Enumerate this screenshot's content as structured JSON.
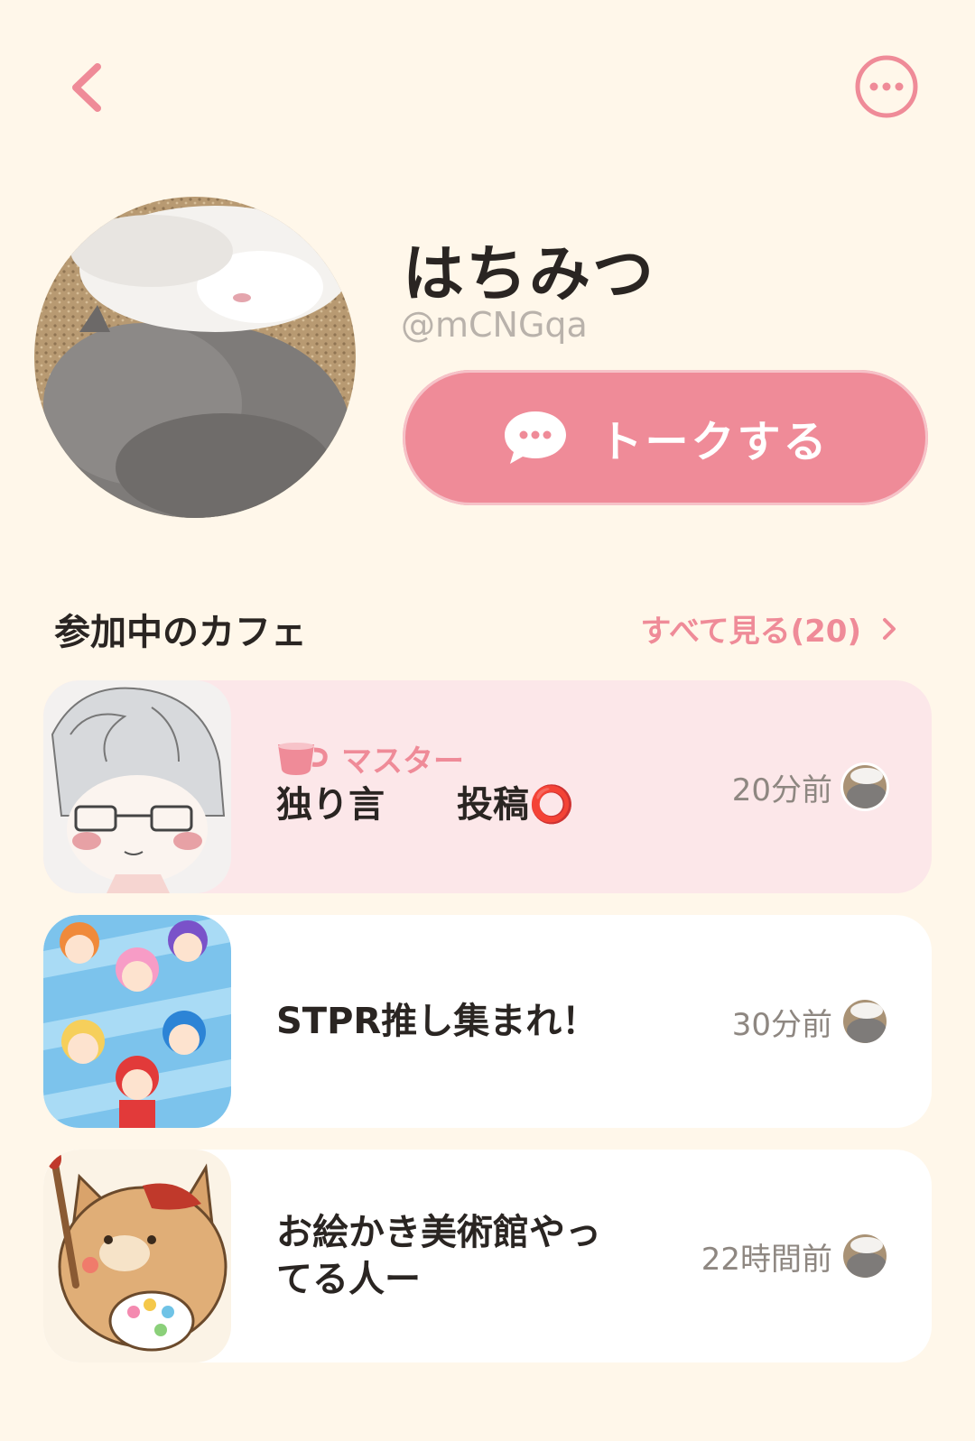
{
  "profile": {
    "name": "はちみつ",
    "handle": "@mCNGqa",
    "avatar_icon": "cat-photo-avatar"
  },
  "actions": {
    "talk_label": "トークする",
    "back_icon": "chevron-left-icon",
    "more_icon": "more-horizontal-icon"
  },
  "section": {
    "title": "参加中のカフェ",
    "see_all": "すべて見る(20)"
  },
  "cafes": [
    {
      "role": "マスター",
      "name": "独り言　　投稿⭕",
      "time": "20分前",
      "highlight": true
    },
    {
      "role": "",
      "name": "STPR推し集まれ！",
      "time": "30分前",
      "highlight": false
    },
    {
      "role": "",
      "name": "お絵かき美術館やっ\nてる人ー",
      "time": "22時間前",
      "highlight": false
    }
  ],
  "colors": {
    "background": "#fff7ea",
    "accent": "#ef8b98",
    "highlight_card": "#fce7e9",
    "text": "#2a2522",
    "muted": "#b9b2ab"
  }
}
